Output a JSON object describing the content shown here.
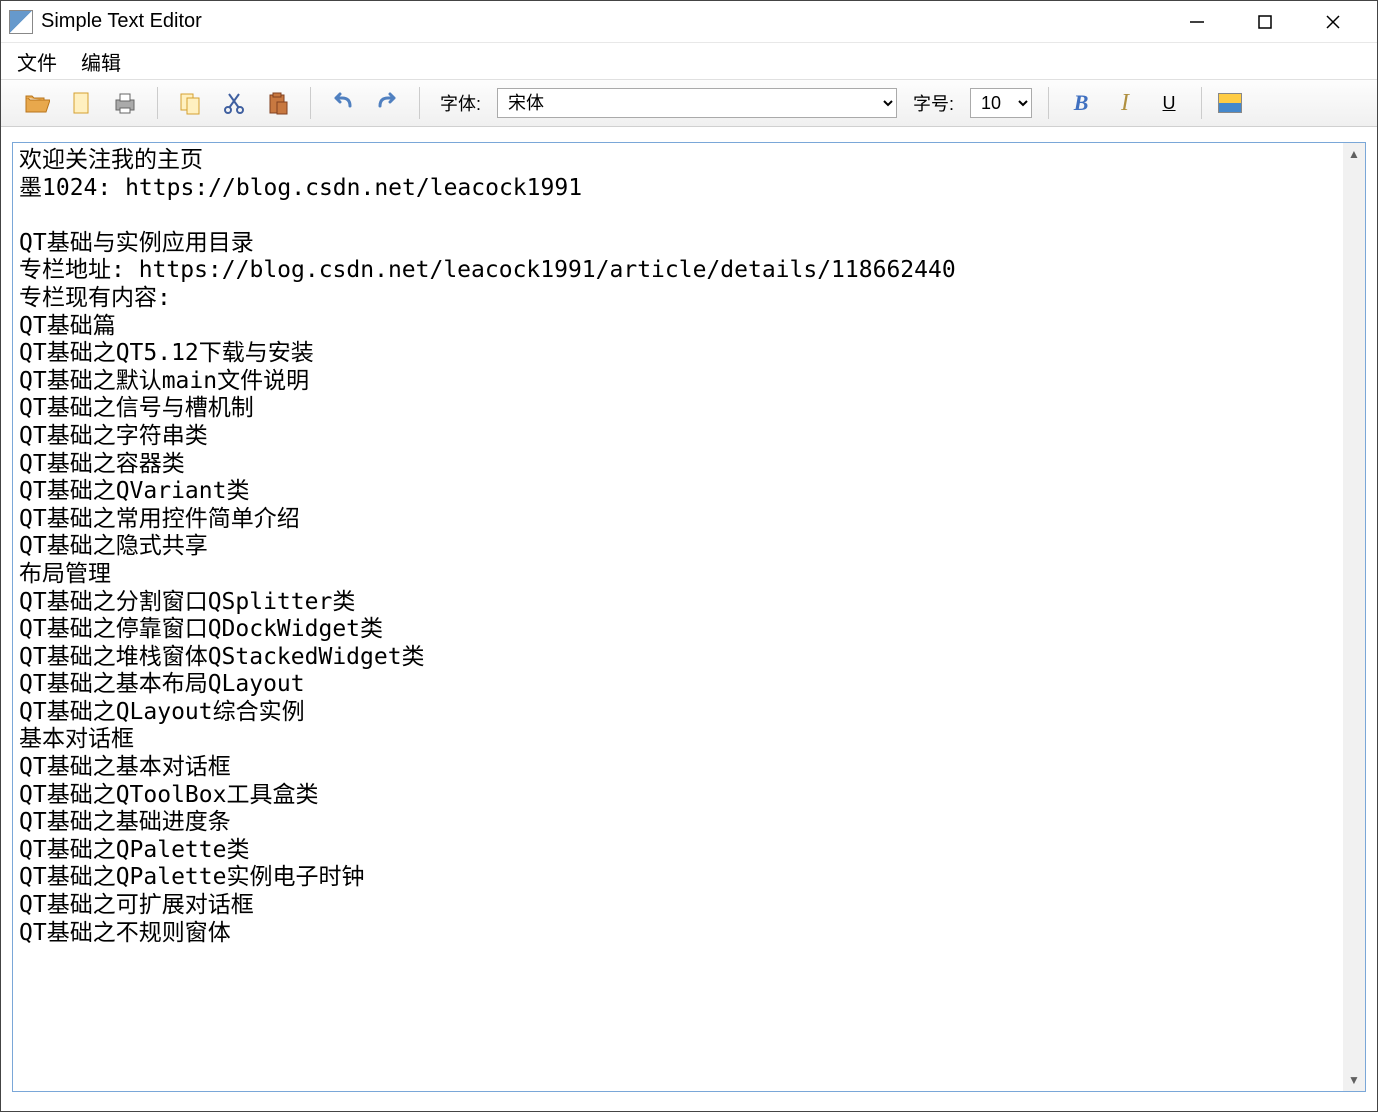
{
  "window": {
    "title": "Simple Text Editor",
    "minimize": "—",
    "maximize": "☐",
    "close": "✕"
  },
  "menubar": {
    "file": "文件",
    "edit": "编辑"
  },
  "toolbar": {
    "font_label": "字体:",
    "font_name": "宋体",
    "size_label": "字号:",
    "font_size": "10",
    "bold": "B",
    "italic": "I",
    "underline": "U"
  },
  "editor": {
    "content": "欢迎关注我的主页\n墨1024: https://blog.csdn.net/leacock1991\n\nQT基础与实例应用目录\n专栏地址: https://blog.csdn.net/leacock1991/article/details/118662440\n专栏现有内容:\nQT基础篇\nQT基础之QT5.12下载与安装\nQT基础之默认main文件说明\nQT基础之信号与槽机制\nQT基础之字符串类\nQT基础之容器类\nQT基础之QVariant类\nQT基础之常用控件简单介绍\nQT基础之隐式共享\n布局管理\nQT基础之分割窗口QSplitter类\nQT基础之停靠窗口QDockWidget类\nQT基础之堆栈窗体QStackedWidget类\nQT基础之基本布局QLayout\nQT基础之QLayout综合实例\n基本对话框\nQT基础之基本对话框\nQT基础之QToolBox工具盒类\nQT基础之基础进度条\nQT基础之QPalette类\nQT基础之QPalette实例电子时钟\nQT基础之可扩展对话框\nQT基础之不规则窗体"
  },
  "scroll": {
    "up": "▲",
    "down": "▼"
  }
}
